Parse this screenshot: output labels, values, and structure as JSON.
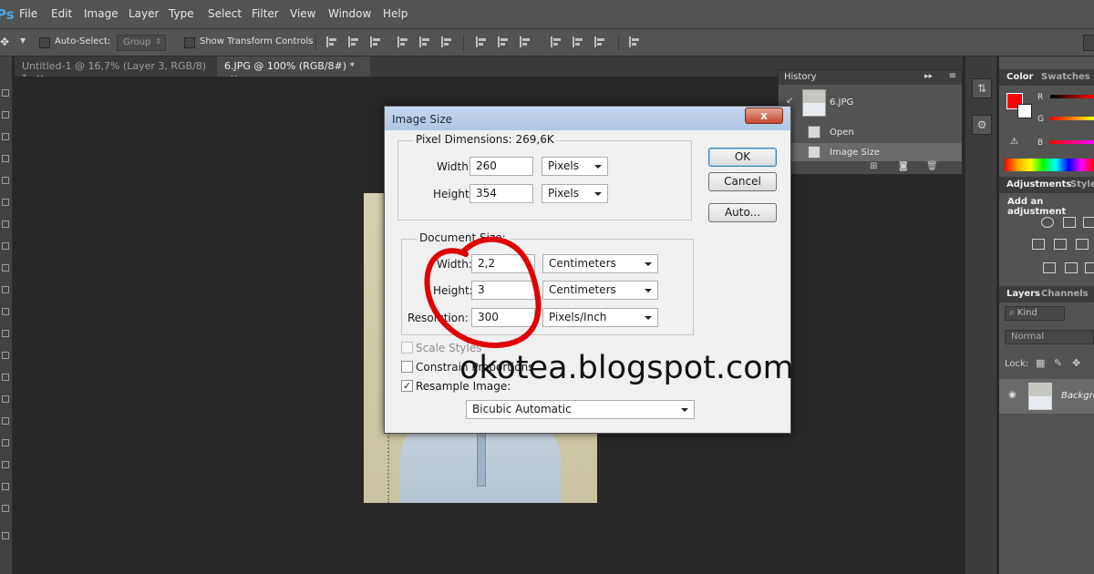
{
  "menubar": {
    "app_icon": "Ps",
    "items": [
      "File",
      "Edit",
      "Image",
      "Layer",
      "Type",
      "Select",
      "Filter",
      "View",
      "Window",
      "Help"
    ]
  },
  "options_bar": {
    "auto_select_label": "Auto-Select:",
    "auto_select_value": "Group",
    "show_transform_label": "Show Transform Controls"
  },
  "tabs": [
    {
      "label": "Untitled-1 @ 16,7% (Layer 3, RGB/8) *",
      "close": "×"
    },
    {
      "label": "6.JPG @ 100% (RGB/8#) *",
      "close": "×"
    }
  ],
  "history": {
    "title": "History",
    "snapshot": "6.JPG",
    "items": [
      "Open",
      "Image Size"
    ]
  },
  "color_panel": {
    "tabs": [
      "Color",
      "Swatches"
    ],
    "channels": [
      "R",
      "G",
      "B"
    ],
    "foreground_color": "#ff0000"
  },
  "adjustments": {
    "tabs": [
      "Adjustments",
      "Styles"
    ],
    "prompt": "Add an adjustment"
  },
  "layers": {
    "tabs": [
      "Layers",
      "Channels"
    ],
    "filter": "Kind",
    "blend_mode": "Normal",
    "lock_label": "Lock:",
    "layer_name": "Background"
  },
  "dialog": {
    "title": "Image Size",
    "close": "x",
    "pixel_dimensions": {
      "label": "Pixel Dimensions:",
      "size": "269,6K",
      "width_label": "Width:",
      "width": "260",
      "width_unit": "Pixels",
      "height_label": "Height:",
      "height": "354",
      "height_unit": "Pixels"
    },
    "document_size": {
      "label": "Document Size:",
      "width_label": "Width:",
      "width": "2,2",
      "width_unit": "Centimeters",
      "height_label": "Height:",
      "height": "3",
      "height_unit": "Centimeters",
      "resolution_label": "Resolution:",
      "resolution": "300",
      "resolution_unit": "Pixels/Inch"
    },
    "scale_styles": "Scale Styles",
    "constrain_proportions": "Constrain Proportions",
    "resample_image": "Resample Image:",
    "resample_method": "Bicubic Automatic",
    "buttons": {
      "ok": "OK",
      "cancel": "Cancel",
      "auto": "Auto..."
    }
  },
  "watermark": "okotea.blogspot.com",
  "annotation_color": "#e00000"
}
